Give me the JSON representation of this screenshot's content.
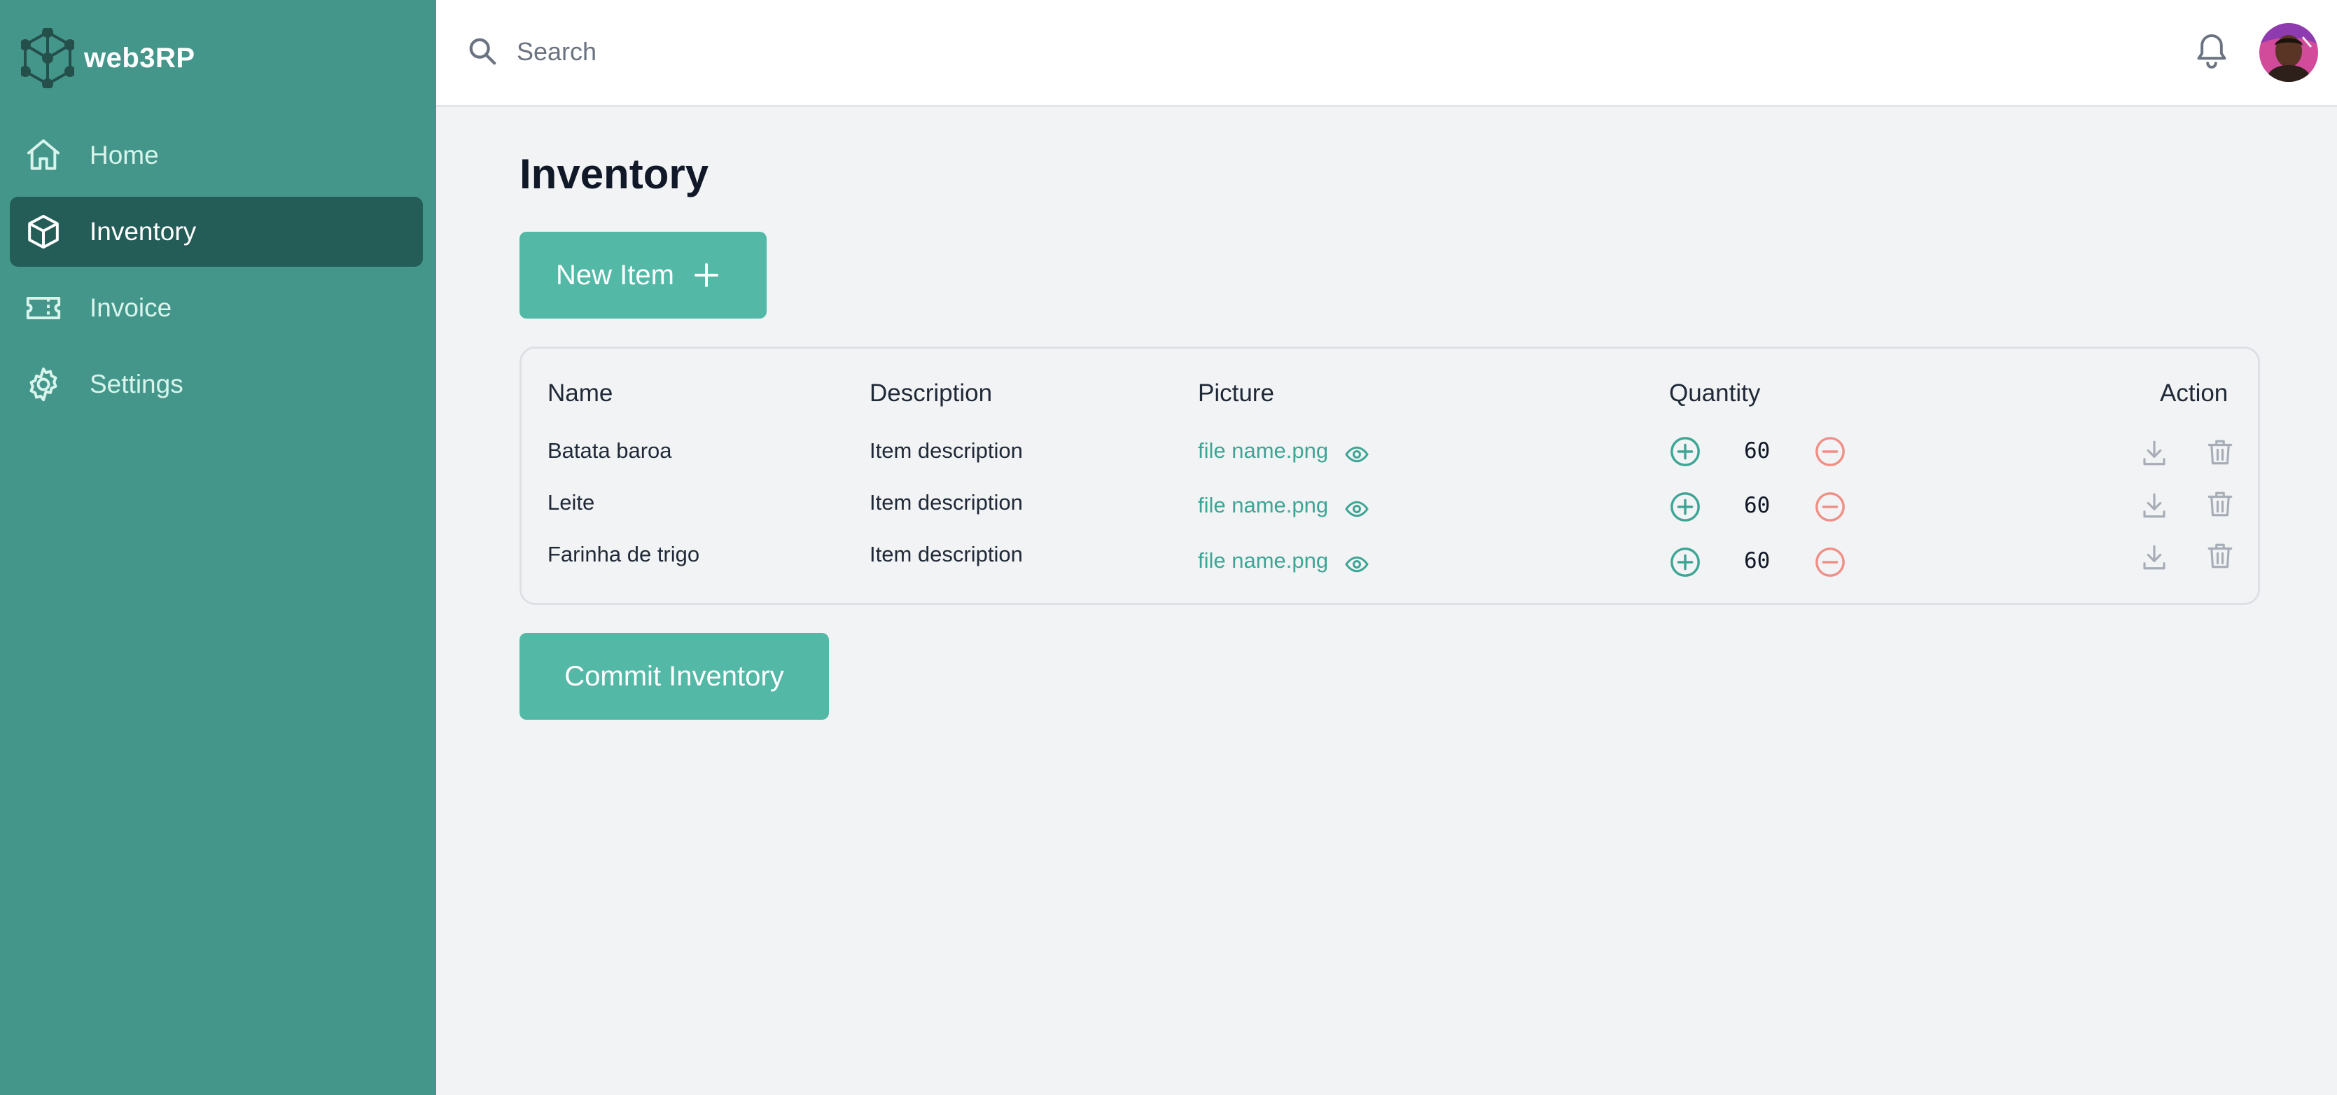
{
  "app": {
    "name": "web3RP"
  },
  "sidebar": {
    "items": [
      {
        "label": "Home",
        "icon": "home-icon",
        "active": false
      },
      {
        "label": "Inventory",
        "icon": "cube-icon",
        "active": true
      },
      {
        "label": "Invoice",
        "icon": "ticket-icon",
        "active": false
      },
      {
        "label": "Settings",
        "icon": "gear-icon",
        "active": false
      }
    ]
  },
  "header": {
    "search_placeholder": "Search",
    "search_value": ""
  },
  "main": {
    "title": "Inventory",
    "new_item_label": "New Item",
    "commit_label": "Commit Inventory",
    "table": {
      "headers": {
        "name": "Name",
        "description": "Description",
        "picture": "Picture",
        "quantity": "Quantity",
        "action": "Action"
      },
      "rows": [
        {
          "name": "Batata baroa",
          "description": "Item description",
          "picture": "file name.png",
          "quantity": "60"
        },
        {
          "name": "Leite",
          "description": "Item description",
          "picture": "file name.png",
          "quantity": "60"
        },
        {
          "name": "Farinha de trigo",
          "description": "Item description",
          "picture": "file name.png",
          "quantity": "60"
        }
      ]
    }
  },
  "colors": {
    "sidebar_bg": "#44968a",
    "sidebar_active": "#245d58",
    "accent": "#54b8a6",
    "link": "#3ea595",
    "increment": "#3ea595",
    "decrement": "#ef8f86",
    "page_bg": "#f2f3f5"
  }
}
